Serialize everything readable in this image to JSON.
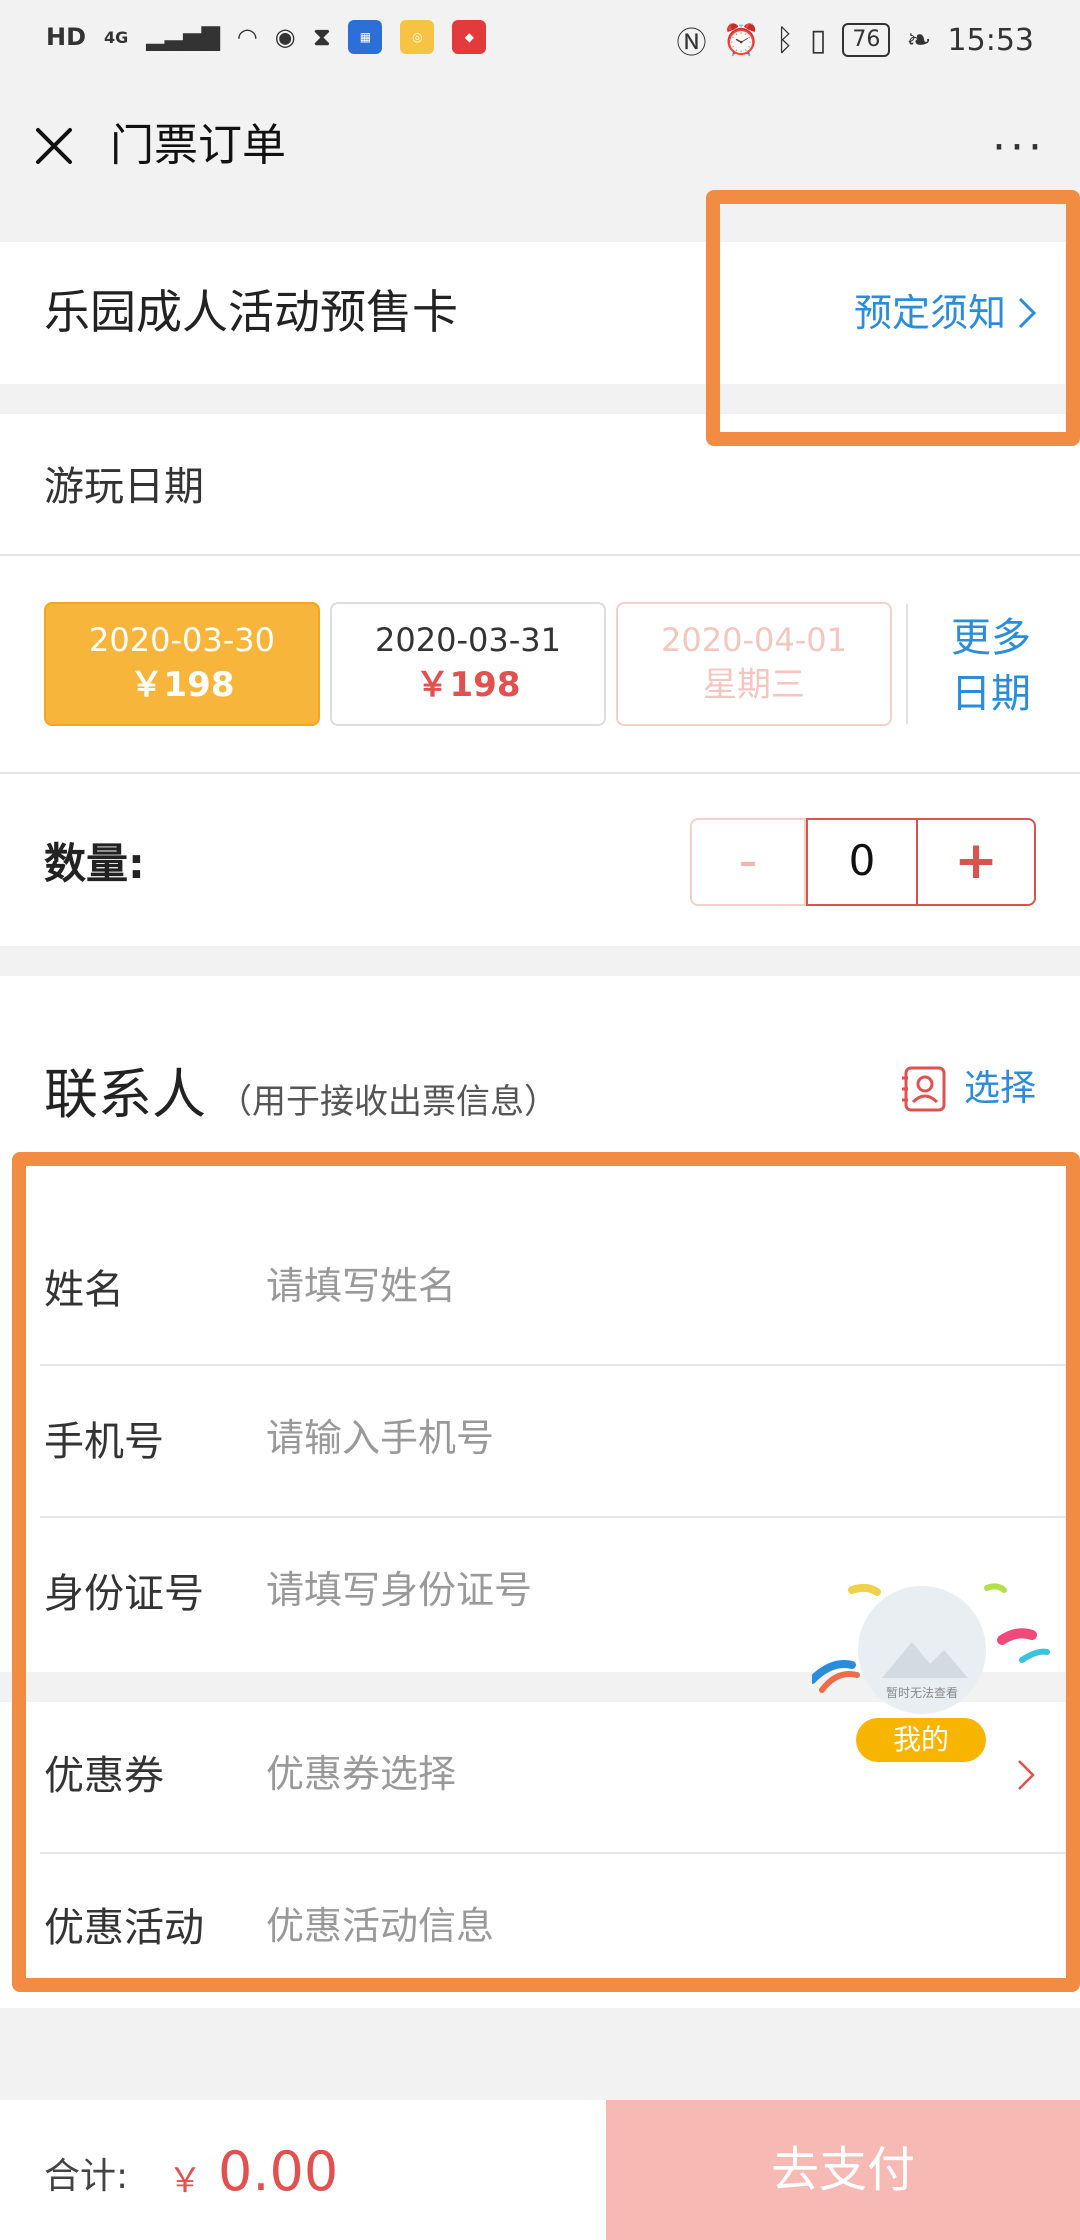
{
  "status_bar": {
    "left_text": "HD",
    "network": "4G",
    "time": "15:53",
    "battery": "76"
  },
  "nav": {
    "title": "门票订单",
    "more": "···"
  },
  "product": {
    "title": "乐园成人活动预售卡",
    "notice_link": "预定须知"
  },
  "date_section": {
    "label": "游玩日期",
    "chips": [
      {
        "date": "2020-03-30",
        "sub": "￥198",
        "state": "selected"
      },
      {
        "date": "2020-03-31",
        "sub": "￥198",
        "state": "normal"
      },
      {
        "date": "2020-04-01",
        "sub": "星期三",
        "state": "disabled"
      }
    ],
    "more_dates_line1": "更多",
    "more_dates_line2": "日期"
  },
  "quantity": {
    "label": "数量:",
    "minus": "-",
    "value": "0",
    "plus": "+"
  },
  "contact": {
    "title": "联系人",
    "subtitle": "（用于接收出票信息）",
    "select": "选择"
  },
  "form": {
    "rows": [
      {
        "label": "姓名",
        "placeholder": "请填写姓名"
      },
      {
        "label": "手机号",
        "placeholder": "请输入手机号"
      },
      {
        "label": "身份证号",
        "placeholder": "请填写身份证号"
      },
      {
        "label": "优惠券",
        "placeholder": "优惠券选择"
      },
      {
        "label": "优惠活动",
        "placeholder": "优惠活动信息"
      }
    ]
  },
  "float_badge": {
    "caption": "暂时无法查看",
    "label": "我的"
  },
  "bottom": {
    "total_label": "合计:",
    "currency": "￥",
    "amount": "0.00",
    "pay_button": "去支付"
  },
  "colors": {
    "accent_blue": "#2b8dd9",
    "selected_chip": "#f8b53b",
    "price_red": "#e0514f",
    "pay_disabled": "#f6b9b3",
    "highlight": "#f28c43"
  }
}
